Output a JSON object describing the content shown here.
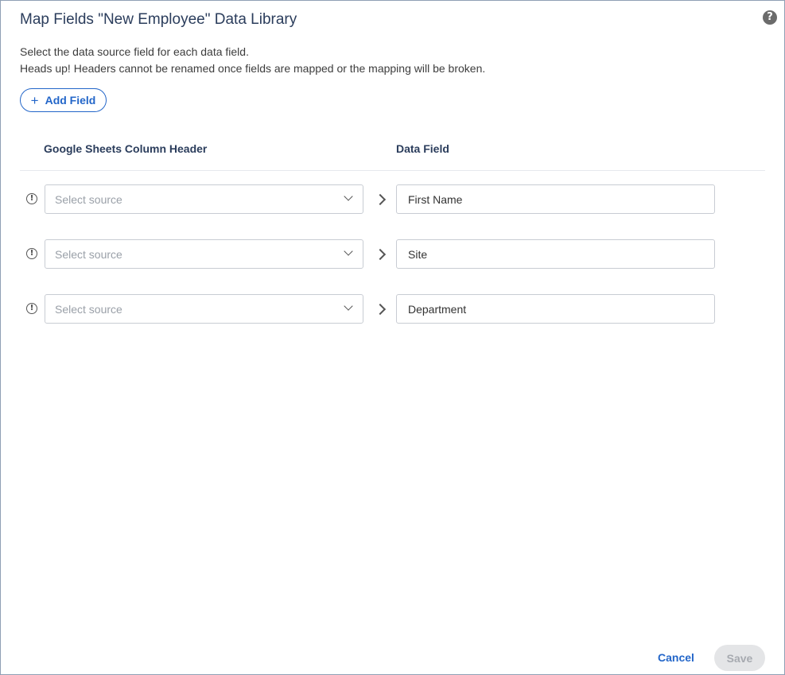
{
  "dialog": {
    "title": "Map Fields \"New Employee\" Data Library",
    "help_icon": "question-circle-icon",
    "help_symbol": "?",
    "description_line1": "Select the data source field for each data field.",
    "description_line2": "Heads up! Headers cannot be renamed once fields are mapped or the mapping will be broken."
  },
  "toolbar": {
    "add_field_icon": "plus-icon",
    "add_field_symbol": "+",
    "add_field_label": "Add Field"
  },
  "columns": {
    "source_header": "Google Sheets Column Header",
    "field_header": "Data Field"
  },
  "rows": [
    {
      "warning_symbol": "!",
      "source_placeholder": "Select source",
      "field_value": "First Name"
    },
    {
      "warning_symbol": "!",
      "source_placeholder": "Select source",
      "field_value": "Site"
    },
    {
      "warning_symbol": "!",
      "source_placeholder": "Select source",
      "field_value": "Department"
    }
  ],
  "footer": {
    "cancel_label": "Cancel",
    "save_label": "Save"
  },
  "colors": {
    "accent": "#2366c9",
    "title": "#2b3d5c",
    "border": "#8f9fb4",
    "save_disabled_bg": "#e4e5e7"
  }
}
